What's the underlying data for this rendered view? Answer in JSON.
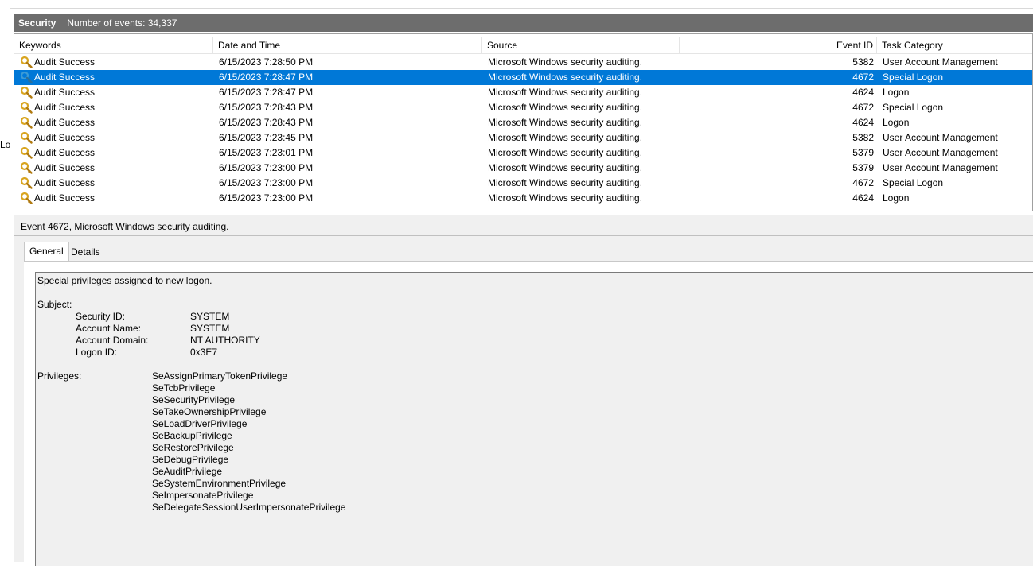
{
  "left_pane": {
    "cut_text": "Lo"
  },
  "header": {
    "title": "Security",
    "count_text": "Number of events: 34,337"
  },
  "columns": [
    "Keywords",
    "Date and Time",
    "Source",
    "Event ID",
    "Task Category"
  ],
  "rows": [
    {
      "keywords": "Audit Success",
      "date": "6/15/2023 7:28:50 PM",
      "source": "Microsoft Windows security auditing.",
      "event_id": "5382",
      "task": "User Account Management",
      "selected": false
    },
    {
      "keywords": "Audit Success",
      "date": "6/15/2023 7:28:47 PM",
      "source": "Microsoft Windows security auditing.",
      "event_id": "4672",
      "task": "Special Logon",
      "selected": true
    },
    {
      "keywords": "Audit Success",
      "date": "6/15/2023 7:28:47 PM",
      "source": "Microsoft Windows security auditing.",
      "event_id": "4624",
      "task": "Logon",
      "selected": false
    },
    {
      "keywords": "Audit Success",
      "date": "6/15/2023 7:28:43 PM",
      "source": "Microsoft Windows security auditing.",
      "event_id": "4672",
      "task": "Special Logon",
      "selected": false
    },
    {
      "keywords": "Audit Success",
      "date": "6/15/2023 7:28:43 PM",
      "source": "Microsoft Windows security auditing.",
      "event_id": "4624",
      "task": "Logon",
      "selected": false
    },
    {
      "keywords": "Audit Success",
      "date": "6/15/2023 7:23:45 PM",
      "source": "Microsoft Windows security auditing.",
      "event_id": "5382",
      "task": "User Account Management",
      "selected": false
    },
    {
      "keywords": "Audit Success",
      "date": "6/15/2023 7:23:01 PM",
      "source": "Microsoft Windows security auditing.",
      "event_id": "5379",
      "task": "User Account Management",
      "selected": false
    },
    {
      "keywords": "Audit Success",
      "date": "6/15/2023 7:23:00 PM",
      "source": "Microsoft Windows security auditing.",
      "event_id": "5379",
      "task": "User Account Management",
      "selected": false
    },
    {
      "keywords": "Audit Success",
      "date": "6/15/2023 7:23:00 PM",
      "source": "Microsoft Windows security auditing.",
      "event_id": "4672",
      "task": "Special Logon",
      "selected": false
    },
    {
      "keywords": "Audit Success",
      "date": "6/15/2023 7:23:00 PM",
      "source": "Microsoft Windows security auditing.",
      "event_id": "4624",
      "task": "Logon",
      "selected": false
    }
  ],
  "detail": {
    "title": "Event 4672, Microsoft Windows security auditing.",
    "tabs": {
      "general": "General",
      "details": "Details"
    },
    "description": "Special privileges assigned to new logon.",
    "subject_label": "Subject:",
    "subject_fields": [
      {
        "label": "Security ID:",
        "value": "SYSTEM"
      },
      {
        "label": "Account Name:",
        "value": "SYSTEM"
      },
      {
        "label": "Account Domain:",
        "value": "NT AUTHORITY"
      },
      {
        "label": "Logon ID:",
        "value": "0x3E7"
      }
    ],
    "privileges_label": "Privileges:",
    "privileges": [
      "SeAssignPrimaryTokenPrivilege",
      "SeTcbPrivilege",
      "SeSecurityPrivilege",
      "SeTakeOwnershipPrivilege",
      "SeLoadDriverPrivilege",
      "SeBackupPrivilege",
      "SeRestorePrivilege",
      "SeDebugPrivilege",
      "SeAuditPrivilege",
      "SeSystemEnvironmentPrivilege",
      "SeImpersonatePrivilege",
      "SeDelegateSessionUserImpersonatePrivilege"
    ]
  },
  "colors": {
    "header_bg": "#6d6d6d",
    "selection": "#0078d7",
    "key_icon": "#d9a520",
    "panel_bg": "#f0f0f0"
  },
  "icons": {
    "row_icon": "key-icon"
  }
}
